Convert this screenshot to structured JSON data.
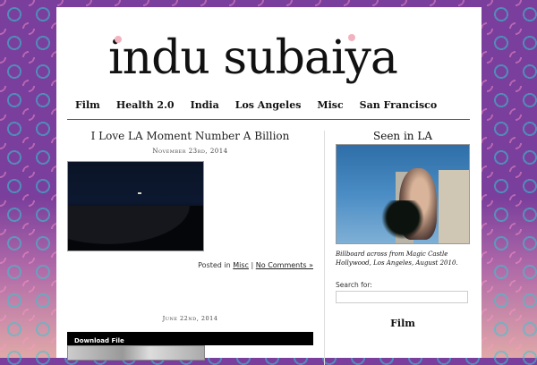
{
  "site": {
    "title": "indu subaiya"
  },
  "nav": {
    "items": [
      "Film",
      "Health 2.0",
      "India",
      "Los Angeles",
      "Misc",
      "San Francisco"
    ]
  },
  "post1": {
    "title": "I Love LA Moment Number A Billion",
    "date": "November 23rd, 2014",
    "posted_in": "Posted in",
    "category": "Misc",
    "separator": "|",
    "comments": "No Comments »"
  },
  "post2": {
    "date": "June 22nd, 2014",
    "download_label": "Download File"
  },
  "sidebar": {
    "seen_heading": "Seen in LA",
    "caption": "Billboard across from Magic Castle Hollywood, Los Angeles, August 2010.",
    "search_label": "Search for:",
    "search_value": "",
    "film_heading": "Film"
  },
  "colors": {
    "background": "#7a3e9c",
    "pattern_accent": "#32c8d2",
    "dot_pink": "#f2b3bf",
    "dot_blue": "#a8d8e6"
  },
  "icons": [
    "logo-dot-pink",
    "logo-dot-blue"
  ]
}
